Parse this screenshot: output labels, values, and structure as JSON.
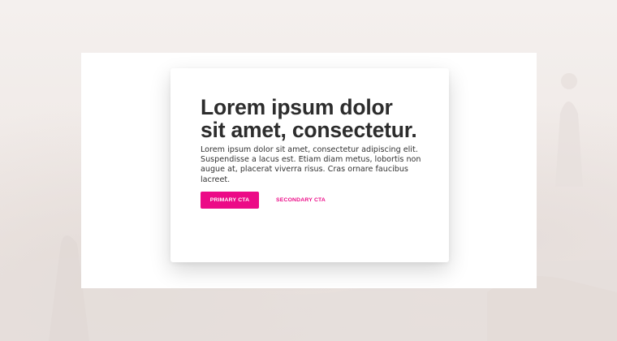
{
  "hero": {
    "title": "Lorem ipsum dolor sit amet, consectetur.",
    "body": "Lorem ipsum dolor sit amet, consectetur adipiscing elit. Suspendisse a lacus est. Etiam diam metus, lobortis non augue at, placerat viverra risus. Cras ornare faucibus lacreet.",
    "primary_cta_label": "PRIMARY CTA",
    "secondary_cta_label": "SECONDARY CTA"
  },
  "colors": {
    "accent": "#ec0a87",
    "heading": "#2d2d2d",
    "background": "#f3eeec",
    "card": "#ffffff"
  }
}
